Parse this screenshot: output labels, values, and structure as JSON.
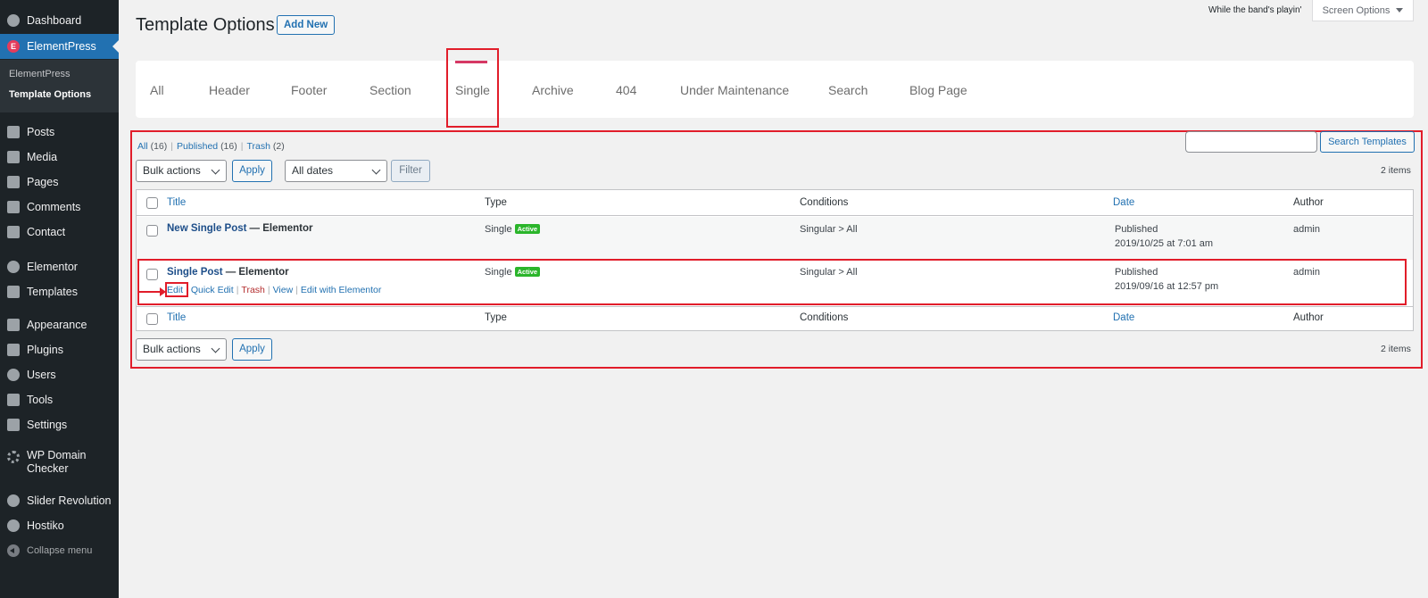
{
  "sidebar": {
    "items": [
      {
        "label": "Dashboard",
        "icon": "dashboard-icon"
      },
      {
        "label": "ElementPress",
        "icon": "elementpress-logo-icon"
      },
      {
        "label": "Posts",
        "icon": "pin-icon"
      },
      {
        "label": "Media",
        "icon": "media-icon"
      },
      {
        "label": "Pages",
        "icon": "pages-icon"
      },
      {
        "label": "Comments",
        "icon": "comment-icon"
      },
      {
        "label": "Contact",
        "icon": "mail-icon"
      },
      {
        "label": "Elementor",
        "icon": "elementor-icon"
      },
      {
        "label": "Templates",
        "icon": "folder-icon"
      },
      {
        "label": "Appearance",
        "icon": "brush-icon"
      },
      {
        "label": "Plugins",
        "icon": "plugin-icon"
      },
      {
        "label": "Users",
        "icon": "user-icon"
      },
      {
        "label": "Tools",
        "icon": "wrench-icon"
      },
      {
        "label": "Settings",
        "icon": "settings-icon"
      },
      {
        "label": "WP Domain",
        "label2": "Checker",
        "icon": "gear-icon"
      },
      {
        "label": "Slider Revolution",
        "icon": "refresh-icon"
      },
      {
        "label": "Hostiko",
        "icon": "dashboard-icon"
      }
    ],
    "submenu": [
      "ElementPress",
      "Template Options"
    ],
    "collapse_label": "Collapse menu"
  },
  "header": {
    "title": "Template Options",
    "add_new": "Add New",
    "band_text": "While the band's playin'",
    "screen_options": "Screen Options"
  },
  "tabs": [
    "All",
    "Header",
    "Footer",
    "Section",
    "Single",
    "Archive",
    "404",
    "Under Maintenance",
    "Search",
    "Blog Page"
  ],
  "active_tab": "Single",
  "filters": {
    "all": "All",
    "all_count": "(16)",
    "published": "Published",
    "published_count": "(16)",
    "trash": "Trash",
    "trash_count": "(2)",
    "bulk_actions": "Bulk actions",
    "apply": "Apply",
    "all_dates": "All dates",
    "filter": "Filter",
    "search_button": "Search Templates",
    "items_count": "2 items"
  },
  "table": {
    "columns": [
      "Title",
      "Type",
      "Conditions",
      "Date",
      "Author"
    ],
    "rows": [
      {
        "title": "New Single Post",
        "suffix": "— Elementor",
        "type": "Single",
        "badge": "Active",
        "conditions": "Singular > All",
        "status": "Published",
        "date": "2019/10/25 at 7:01 am",
        "author": "admin"
      },
      {
        "title": "Single Post",
        "suffix": "— Elementor",
        "type": "Single",
        "badge": "Active",
        "conditions": "Singular > All",
        "status": "Published",
        "date": "2019/09/16 at 12:57 pm",
        "author": "admin"
      }
    ],
    "row_actions": [
      "Edit",
      "Quick Edit",
      "Trash",
      "View",
      "Edit with Elementor"
    ]
  },
  "colors": {
    "sidebar_bg": "#1d2327",
    "accent": "#2271b1",
    "highlight": "#e11d2a",
    "tab_indicator": "#d63864",
    "active_badge": "#2bb52b"
  }
}
